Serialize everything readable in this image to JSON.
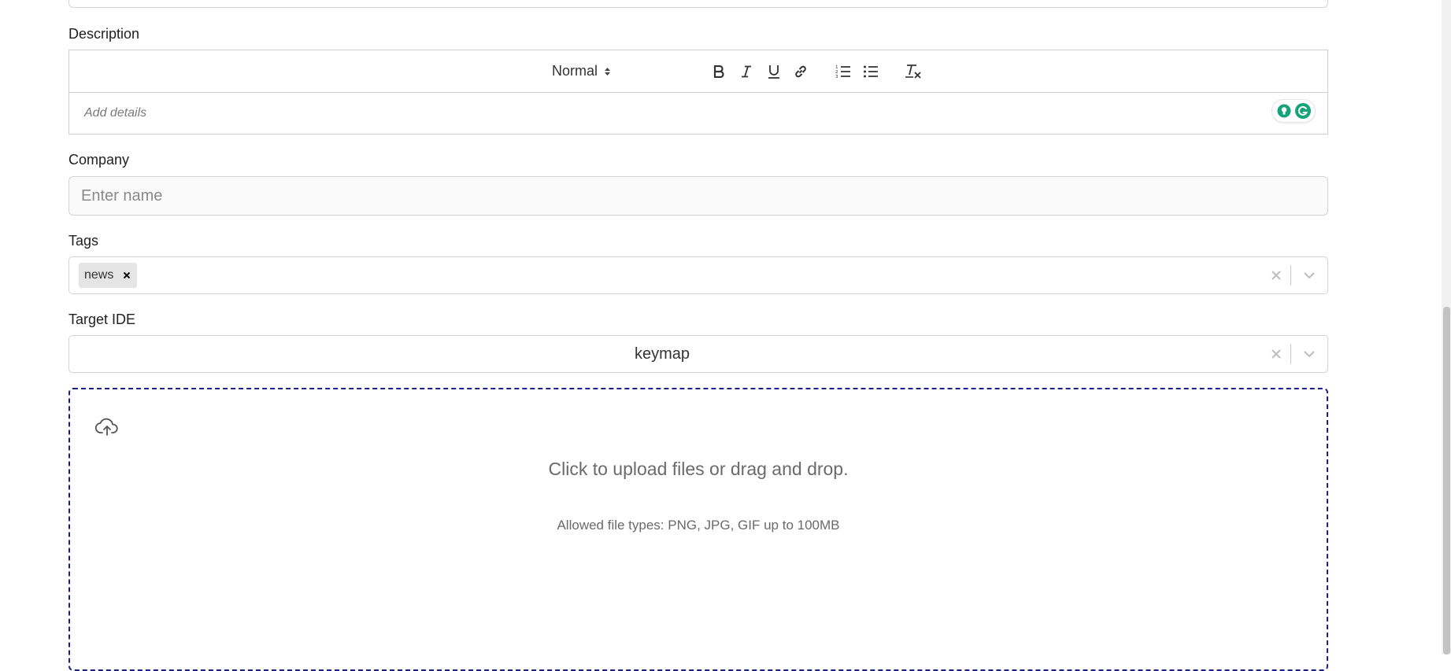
{
  "description": {
    "label": "Description",
    "toolbar": {
      "heading_select": "Normal",
      "buttons": [
        "bold-icon",
        "italic-icon",
        "underline-icon",
        "link-icon",
        "ordered-list-icon",
        "bullet-list-icon",
        "clear-format-icon"
      ]
    },
    "placeholder": "Add details"
  },
  "company": {
    "label": "Company",
    "placeholder": "Enter name",
    "value": ""
  },
  "tags": {
    "label": "Tags",
    "chips": [
      "news"
    ]
  },
  "target_ide": {
    "label": "Target IDE",
    "value": "keymap"
  },
  "upload": {
    "icon": "cloud-upload-icon",
    "main_text": "Click to upload files or drag and drop.",
    "sub_text": "Allowed file types: PNG, JPG, GIF up to 100MB"
  },
  "colors": {
    "dropzone_border": "#1a1f8f",
    "grammarly": "#15a37a"
  }
}
